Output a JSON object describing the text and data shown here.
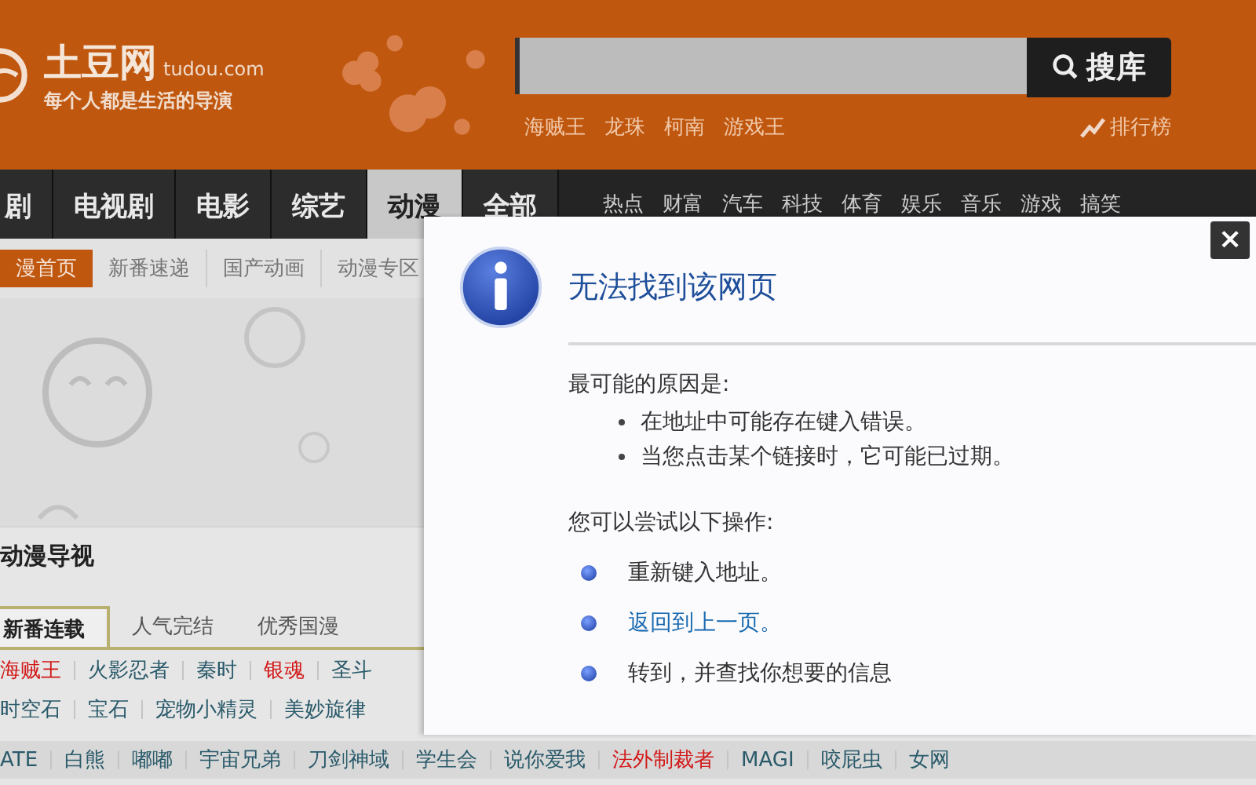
{
  "header": {
    "logo_name": "土豆网",
    "logo_domain": "tudou.com",
    "slogan": "每个人都是生活的导演",
    "search": {
      "button": "搜库"
    },
    "hot_searches": [
      "海贼王",
      "龙珠",
      "柯南",
      "游戏王"
    ],
    "ranking_link": "排行榜"
  },
  "nav": {
    "main_tabs": [
      {
        "label": "剧",
        "selected": false
      },
      {
        "label": "电视剧",
        "selected": false
      },
      {
        "label": "电影",
        "selected": false
      },
      {
        "label": "综艺",
        "selected": false
      },
      {
        "label": "动漫",
        "selected": true
      },
      {
        "label": "全部",
        "selected": false
      }
    ],
    "channels": [
      "热点",
      "财富",
      "汽车",
      "科技",
      "体育",
      "娱乐",
      "音乐",
      "游戏",
      "搞笑"
    ]
  },
  "sub_nav": [
    {
      "label": "漫首页",
      "selected": true
    },
    {
      "label": "新番速递",
      "selected": false
    },
    {
      "label": "国产动画",
      "selected": false
    },
    {
      "label": "动漫专区",
      "selected": false
    }
  ],
  "section": {
    "title": "动漫导视",
    "tabs": [
      {
        "label": "新番连载",
        "selected": true
      },
      {
        "label": "人气完结",
        "selected": false
      },
      {
        "label": "优秀国漫",
        "selected": false
      }
    ],
    "rows": [
      [
        {
          "label": "海贼王",
          "hot": true
        },
        {
          "label": "火影忍者",
          "hot": false
        },
        {
          "label": "秦时",
          "hot": false
        },
        {
          "label": "银魂",
          "hot": true
        },
        {
          "label": "圣斗",
          "hot": false
        }
      ],
      [
        {
          "label": "时空石",
          "hot": false
        },
        {
          "label": "宝石",
          "hot": false
        },
        {
          "label": "宠物小精灵",
          "hot": false
        },
        {
          "label": "美妙旋律",
          "hot": false
        }
      ],
      [
        {
          "label": "ATE",
          "hot": false
        },
        {
          "label": "白熊",
          "hot": false
        },
        {
          "label": "嘟嘟",
          "hot": false
        },
        {
          "label": "宇宙兄弟",
          "hot": false
        },
        {
          "label": "刀剑神域",
          "hot": false
        },
        {
          "label": "学生会",
          "hot": false
        },
        {
          "label": "说你爱我",
          "hot": false
        },
        {
          "label": "法外制裁者",
          "hot": true
        },
        {
          "label": "MAGI",
          "hot": false
        },
        {
          "label": "咬屁虫",
          "hot": false
        },
        {
          "label": "女网",
          "hot": false
        }
      ]
    ]
  },
  "dialog": {
    "title": "无法找到该网页",
    "close": "×",
    "causes_heading": "最可能的原因是:",
    "causes": [
      "在地址中可能存在键入错误。",
      "当您点击某个链接时，它可能已过期。"
    ],
    "actions_heading": "您可以尝试以下操作:",
    "actions": [
      {
        "text": "重新键入地址。",
        "kind": "text"
      },
      {
        "text": "返回到上一页。",
        "kind": "link"
      },
      {
        "text": "转到，并查找你想要的信息",
        "kind": "text"
      }
    ]
  }
}
